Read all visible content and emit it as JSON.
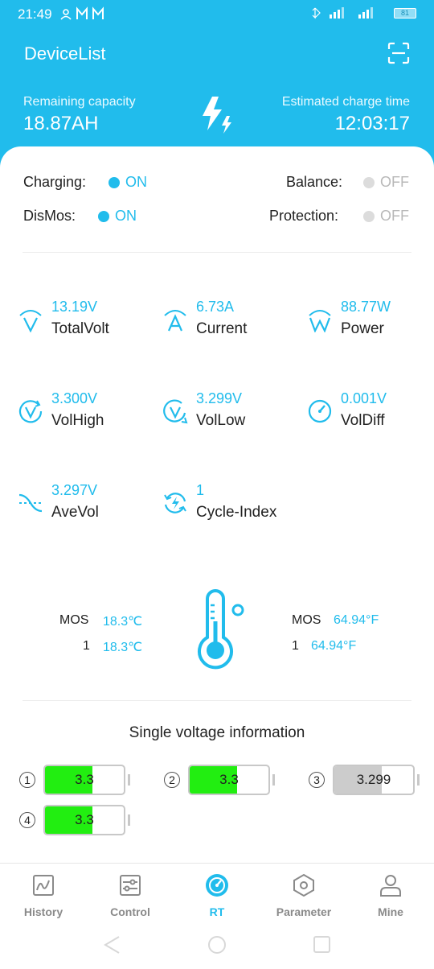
{
  "status_bar": {
    "time": "21:49",
    "battery": "81"
  },
  "header": {
    "title": "DeviceList",
    "remaining_label": "Remaining capacity",
    "remaining_value": "18.87AH",
    "charge_time_label": "Estimated charge time",
    "charge_time_value": "12:03:17"
  },
  "states": {
    "charging": {
      "label": "Charging:",
      "value": "ON"
    },
    "balance": {
      "label": "Balance:",
      "value": "OFF"
    },
    "dismos": {
      "label": "DisMos:",
      "value": "ON"
    },
    "protection": {
      "label": "Protection:",
      "value": "OFF"
    }
  },
  "metrics": {
    "total_volt": {
      "value": "13.19V",
      "label": "TotalVolt"
    },
    "current": {
      "value": "6.73A",
      "label": "Current"
    },
    "power": {
      "value": "88.77W",
      "label": "Power"
    },
    "vol_high": {
      "value": "3.300V",
      "label": "VolHigh"
    },
    "vol_low": {
      "value": "3.299V",
      "label": "VolLow"
    },
    "vol_diff": {
      "value": "0.001V",
      "label": "VolDiff"
    },
    "ave_vol": {
      "value": "3.297V",
      "label": "AveVol"
    },
    "cycle_index": {
      "value": "1",
      "label": "Cycle-Index"
    }
  },
  "temperature": {
    "c_rows": [
      {
        "label": "MOS",
        "value": "18.3℃"
      },
      {
        "label": "1",
        "value": "18.3℃"
      }
    ],
    "f_rows": [
      {
        "label": "MOS",
        "value": "64.94°F"
      },
      {
        "label": "1",
        "value": "64.94°F"
      }
    ]
  },
  "single_voltage": {
    "title": "Single voltage information",
    "cells": [
      {
        "num": "1",
        "value": "3.3",
        "fill_percent": 60,
        "color": "#22ee11"
      },
      {
        "num": "2",
        "value": "3.3",
        "fill_percent": 60,
        "color": "#22ee11"
      },
      {
        "num": "3",
        "value": "3.299",
        "fill_percent": 60,
        "color": "#cccccc"
      },
      {
        "num": "4",
        "value": "3.3",
        "fill_percent": 60,
        "color": "#22ee11"
      }
    ]
  },
  "nav": {
    "history": "History",
    "control": "Control",
    "rt": "RT",
    "parameter": "Parameter",
    "mine": "Mine",
    "active": "RT"
  },
  "colors": {
    "accent": "#21bcec",
    "on": "#21bcec",
    "off": "#dcdcdc"
  }
}
